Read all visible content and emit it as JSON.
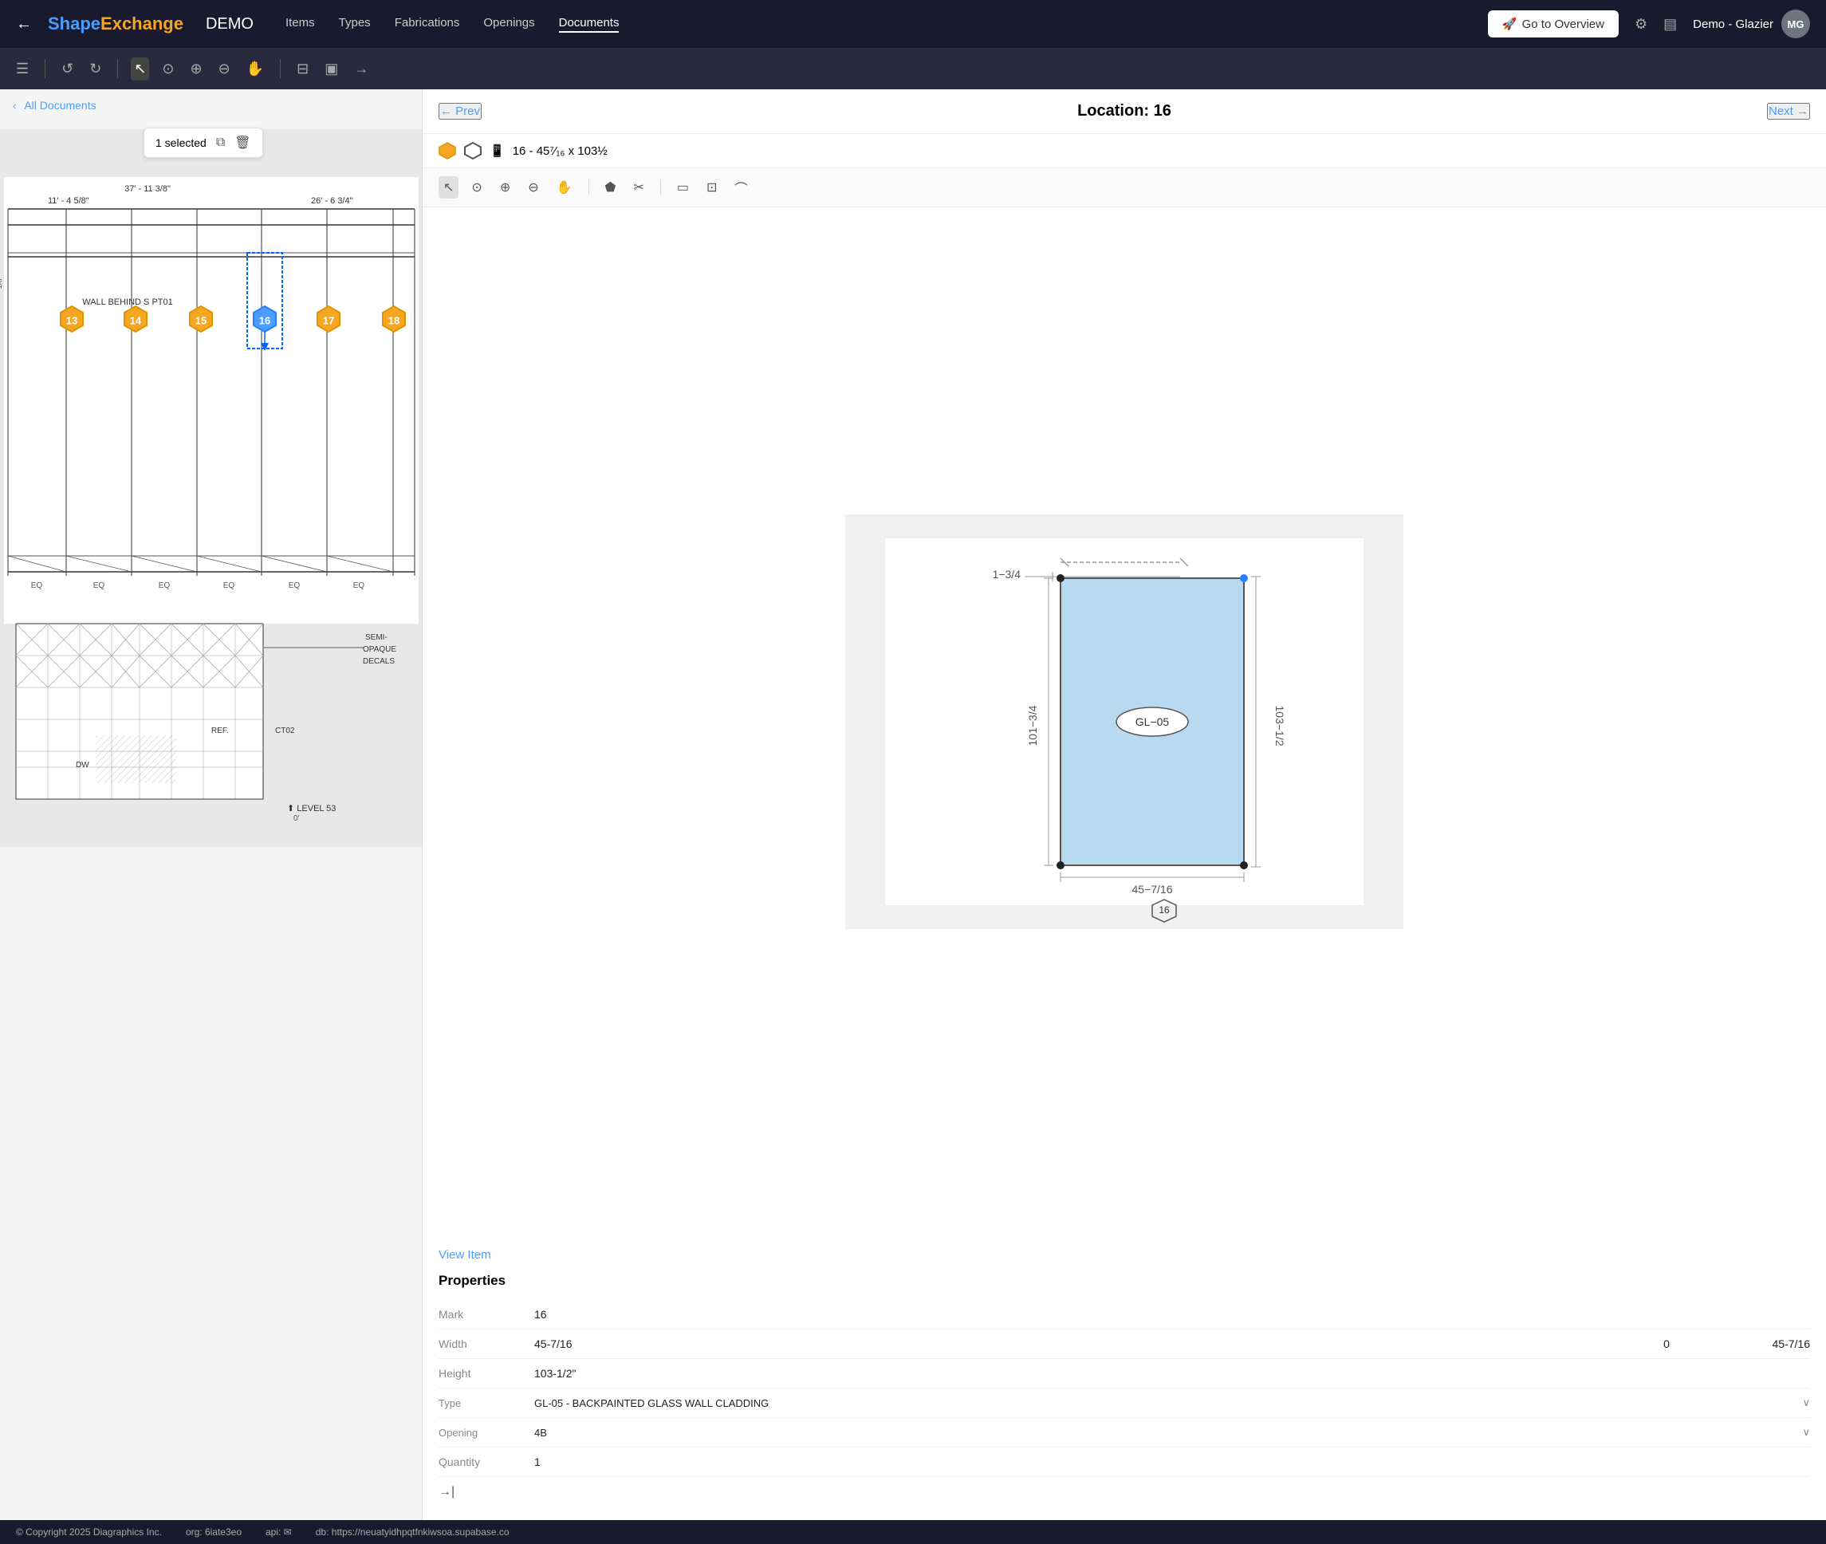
{
  "app": {
    "brand_shape": "Shape",
    "brand_exchange": "Exchange",
    "brand_demo": "DEMO",
    "user_name": "Demo - Glazier",
    "user_initials": "MG",
    "go_to_overview": "Go to Overview"
  },
  "nav": {
    "items": [
      "Items",
      "Types",
      "Fabrications",
      "Openings",
      "Documents"
    ],
    "active": "Documents"
  },
  "toolbar_icons": [
    "←",
    "↺",
    "↻",
    "↖",
    "⊙",
    "+",
    "−",
    "✋",
    "⊟",
    "▣",
    "→"
  ],
  "left_panel": {
    "all_docs": "All Documents",
    "selected_count": "1 selected"
  },
  "right_panel": {
    "prev_label": "← Prev",
    "next_label": "Next →",
    "location_label": "Location: 16",
    "item_subtitle": "16 - 45⁷⁄₁₆ x 103½",
    "view_item": "View Item",
    "properties_title": "Properties",
    "properties": [
      {
        "label": "Mark",
        "value": "16",
        "value2": "",
        "value3": ""
      },
      {
        "label": "Width",
        "value": "45-7/16",
        "value2": "0",
        "value3": "45-7/16"
      },
      {
        "label": "Height",
        "value": "103-1/2\"",
        "value2": "",
        "value3": ""
      },
      {
        "label": "Type",
        "value": "GL-05 - BACKPAINTED GLASS WALL CLADDING",
        "value2": "",
        "value3": "",
        "expandable": true
      },
      {
        "label": "Opening",
        "value": "4B",
        "value2": "",
        "value3": "",
        "expandable": true
      },
      {
        "label": "Quantity",
        "value": "1",
        "value2": "",
        "value3": ""
      }
    ],
    "drawing": {
      "dim_top": "1-3/4",
      "dim_left": "101-3/4",
      "dim_right": "103-1/2",
      "dim_bottom": "45-7/16",
      "label": "GL-05",
      "mark": "16"
    }
  },
  "footer": {
    "copyright": "© Copyright 2025 Diagraphics Inc.",
    "org": "org: 6iate3eo",
    "api": "api: ✉",
    "db": "db: https://neuatyidhpqtfnkiwsoa.supabase.co"
  }
}
